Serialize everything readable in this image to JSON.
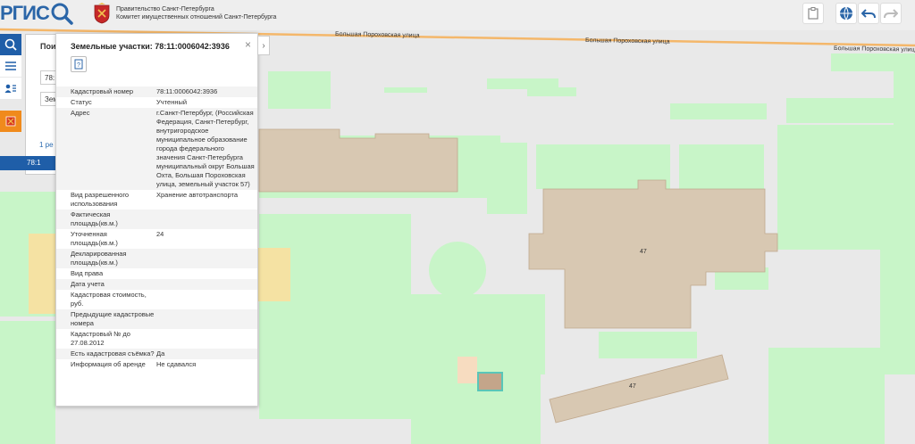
{
  "header": {
    "logo_text": "РГИС",
    "gov_line1": "Правительство Санкт-Петербурга",
    "gov_line2": "Комитет имущественных отношений Санкт-Петербурга"
  },
  "map": {
    "street_labels": [
      "Большая Пороховская улица",
      "Большая Пороховская улица",
      "Большая Пороховская улица"
    ],
    "building_numbers": [
      "47",
      "47"
    ],
    "colors": {
      "background": "#e9e9e9",
      "green": "#c8f5c8",
      "building": "#d8c8b2",
      "highlight": "#59c6b9",
      "road_orange": "#f4b76a"
    }
  },
  "search_panel": {
    "title": "Пои",
    "field1": "78:",
    "field2": "Зем",
    "count": "1 ре",
    "row": "78:1"
  },
  "popup": {
    "title": "Земельные участки: 78:11:0006042:3936",
    "close": "×",
    "next": "›",
    "rows": [
      {
        "key": "Кадастровый номер",
        "value": "78:11:0006042:3936"
      },
      {
        "key": "Статус",
        "value": "Учтенный"
      },
      {
        "key": "Адрес",
        "value": "г.Санкт-Петербург, (Российская Федерация, Санкт-Петербург, внутригородское муниципальное образование города федерального значения Санкт-Петербурга муниципальный округ Большая Охта, Большая Пороховская улица, земельный участок 57)"
      },
      {
        "key": "Вид разрешенного использования",
        "value": "Хранение автотранспорта"
      },
      {
        "key": "Фактическая площадь(кв.м.)",
        "value": ""
      },
      {
        "key": "Уточненная площадь(кв.м.)",
        "value": "24"
      },
      {
        "key": "Декларированная площадь(кв.м.)",
        "value": ""
      },
      {
        "key": "Вид права",
        "value": ""
      },
      {
        "key": "Дата учета",
        "value": ""
      },
      {
        "key": "Кадастровая стоимость, руб.",
        "value": ""
      },
      {
        "key": "Предыдущие кадастровые номера",
        "value": ""
      },
      {
        "key": "Кадастровый № до 27.08.2012",
        "value": ""
      },
      {
        "key": "Есть кадастровая съёмка?",
        "value": "Да"
      },
      {
        "key": "Информация об аренде",
        "value": "Не сдавался"
      }
    ]
  }
}
